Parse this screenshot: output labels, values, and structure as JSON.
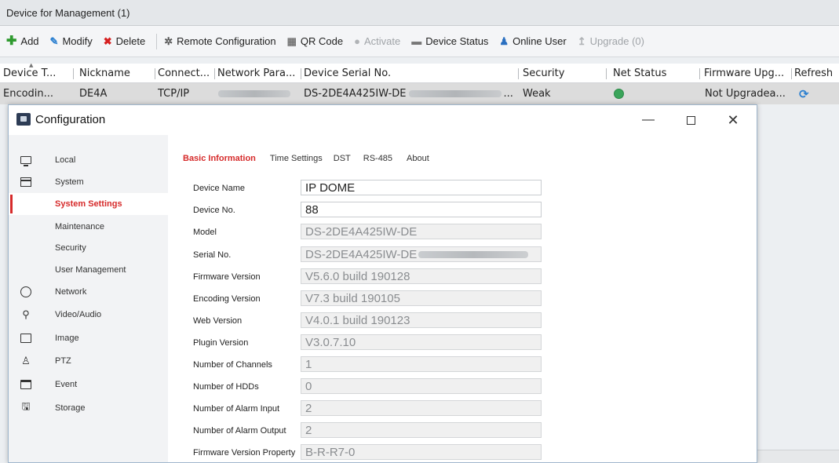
{
  "panel_title": "Device for Management (1)",
  "toolbar": {
    "add": "Add",
    "modify": "Modify",
    "delete": "Delete",
    "remote_config": "Remote Configuration",
    "qr_code": "QR Code",
    "activate": "Activate",
    "device_status": "Device Status",
    "online_user": "Online User",
    "upgrade": "Upgrade (0)"
  },
  "table": {
    "headers": [
      "Device T...",
      "Nickname",
      "Connect...",
      "Network Para...",
      "Device Serial No.",
      "Security",
      "Net Status",
      "Firmware Upg...",
      "Refresh"
    ],
    "row": {
      "device_type": "Encodin...",
      "nickname": "DE4A",
      "connection": "TCP/IP",
      "serial": "DS-2DE4A425IW-DE",
      "serial_suffix": "...",
      "security": "Weak",
      "firmware_upgrade": "Not Upgradea..."
    }
  },
  "dialog": {
    "title": "Configuration",
    "sidebar": [
      {
        "label": "Local",
        "icon": "monitor-icon"
      },
      {
        "label": "System",
        "icon": "system-icon"
      },
      {
        "label": "System Settings",
        "icon": ""
      },
      {
        "label": "Maintenance",
        "icon": ""
      },
      {
        "label": "Security",
        "icon": ""
      },
      {
        "label": "User Management",
        "icon": ""
      },
      {
        "label": "Network",
        "icon": "network-icon"
      },
      {
        "label": "Video/Audio",
        "icon": "video-audio-icon"
      },
      {
        "label": "Image",
        "icon": "image-icon"
      },
      {
        "label": "PTZ",
        "icon": "ptz-icon"
      },
      {
        "label": "Event",
        "icon": "event-icon"
      },
      {
        "label": "Storage",
        "icon": "storage-icon"
      }
    ],
    "tabs": [
      "Basic Information",
      "Time Settings",
      "DST",
      "RS-485",
      "About"
    ],
    "fields": [
      {
        "label": "Device Name",
        "value": "IP DOME"
      },
      {
        "label": "Device No.",
        "value": "88"
      },
      {
        "label": "Model",
        "value": "DS-2DE4A425IW-DE"
      },
      {
        "label": "Serial No.",
        "value": "DS-2DE4A425IW-DE"
      },
      {
        "label": "Firmware Version",
        "value": "V5.6.0 build 190128"
      },
      {
        "label": "Encoding Version",
        "value": "V7.3 build 190105"
      },
      {
        "label": "Web Version",
        "value": "V4.0.1 build 190123"
      },
      {
        "label": "Plugin Version",
        "value": "V3.0.7.10"
      },
      {
        "label": "Number of Channels",
        "value": "1"
      },
      {
        "label": "Number of HDDs",
        "value": "0"
      },
      {
        "label": "Number of Alarm Input",
        "value": "2"
      },
      {
        "label": "Number of Alarm Output",
        "value": "2"
      },
      {
        "label": "Firmware Version Property",
        "value": "B-R-R7-0"
      }
    ]
  },
  "colors": {
    "accent_red": "#d62b2b",
    "add_green": "#2f9a2f",
    "delete_red": "#d62020",
    "icon_blue": "#2a7fd0",
    "net_status_green": "#3aa45a"
  }
}
